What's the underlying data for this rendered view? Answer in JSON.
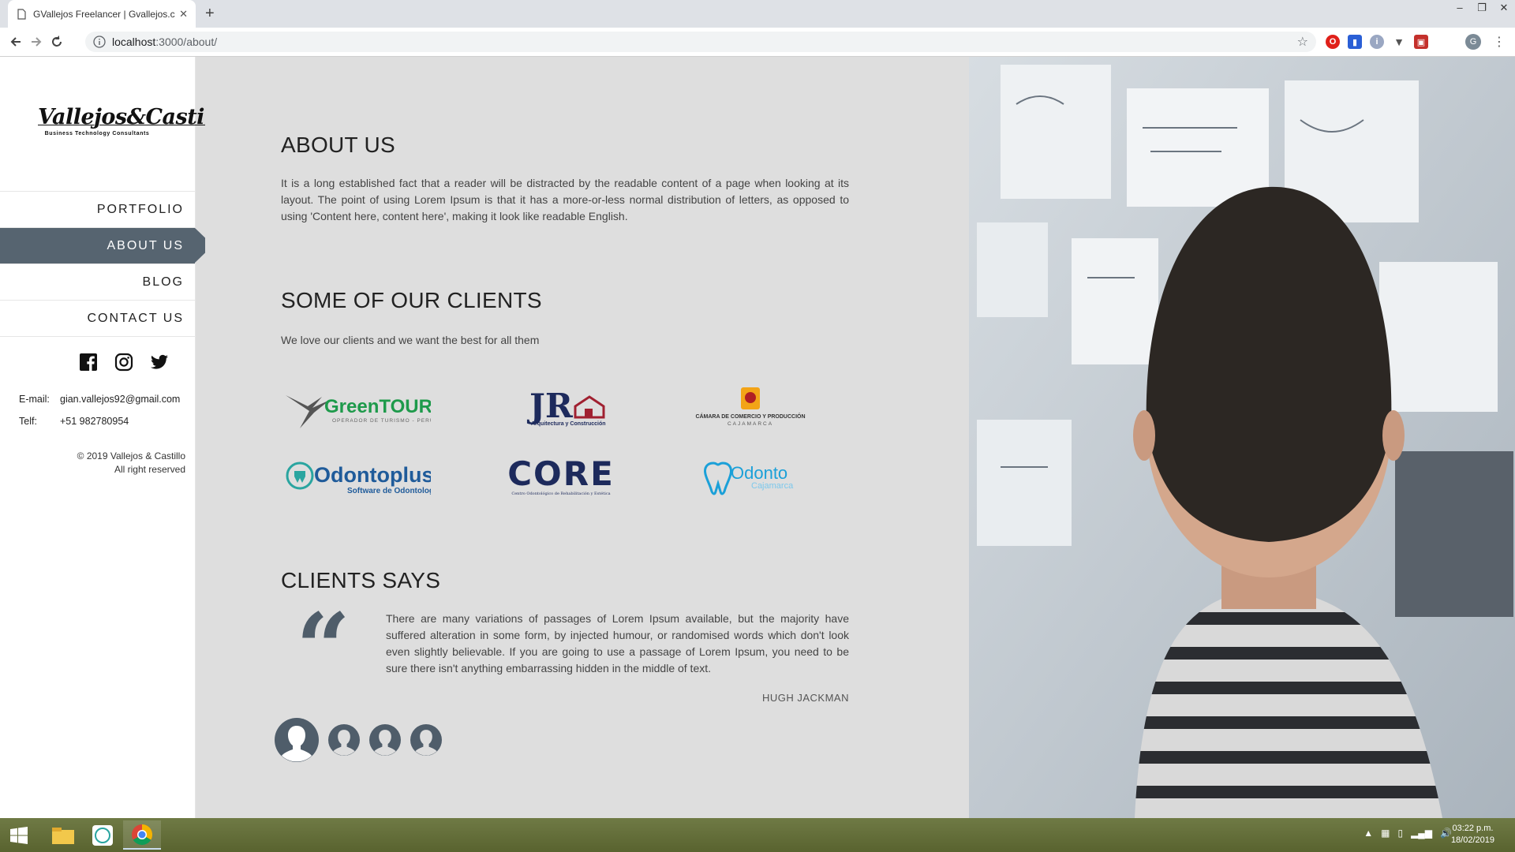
{
  "browser": {
    "tab_title": "GVallejos Freelancer | Gvallejos.c",
    "url_host": "localhost",
    "url_path": ":3000/about/",
    "profile_initial": "G"
  },
  "sidebar": {
    "logo_text": "Vallejos&Castillo",
    "logo_tagline": "Business Technology Consultants",
    "menu": [
      {
        "label": "PORTFOLIO"
      },
      {
        "label": "ABOUT US"
      },
      {
        "label": "BLOG"
      },
      {
        "label": "CONTACT US"
      }
    ],
    "email_label": "E-mail:",
    "email": "gian.vallejos92@gmail.com",
    "phone_label": "Telf:",
    "phone": "+51 982780954",
    "copyright": "© 2019 Vallejos & Castillo",
    "rights": "All right reserved"
  },
  "about": {
    "title": "ABOUT US",
    "text": "It is a long established fact that a reader will be distracted by the readable content of a page when looking at its layout. The point of using Lorem Ipsum is that it has a more-or-less normal distribution of letters, as opposed to using 'Content here, content here', making it look like readable English."
  },
  "clients_section": {
    "title": "SOME OF OUR CLIENTS",
    "subtitle": "We love our clients and we want the best for all them",
    "logos": [
      {
        "name": "GreenTOURS",
        "sub": "OPERADOR DE TURISMO - PERÚ"
      },
      {
        "name": "JR",
        "sub": "Arquitectura y Construcción"
      },
      {
        "name": "CÁMARA DE COMERCIO Y PRODUCCIÓN",
        "sub": "CAJAMARCA"
      },
      {
        "name": "Odontoplus",
        "sub": "Software de Odontología"
      },
      {
        "name": "CORE",
        "sub": "Centro Odontológico de Rehabilitación y Estética"
      },
      {
        "name": "Odonto",
        "sub": "Cajamarca"
      }
    ]
  },
  "testimonials": {
    "title": "CLIENTS SAYS",
    "quote": "There are many variations of passages of Lorem Ipsum available, but the majority have suffered alteration in some form, by injected humour, or randomised words which don't look even slightly believable. If you are going to use a passage of Lorem Ipsum, you need to be sure there isn't anything embarrassing hidden in the middle of text.",
    "author": "HUGH JACKMAN"
  },
  "taskbar": {
    "time": "03:22 p.m.",
    "date": "18/02/2019"
  },
  "colors": {
    "accent": "#566470",
    "main_bg": "#dedede",
    "quote": "#4f5d6a"
  }
}
